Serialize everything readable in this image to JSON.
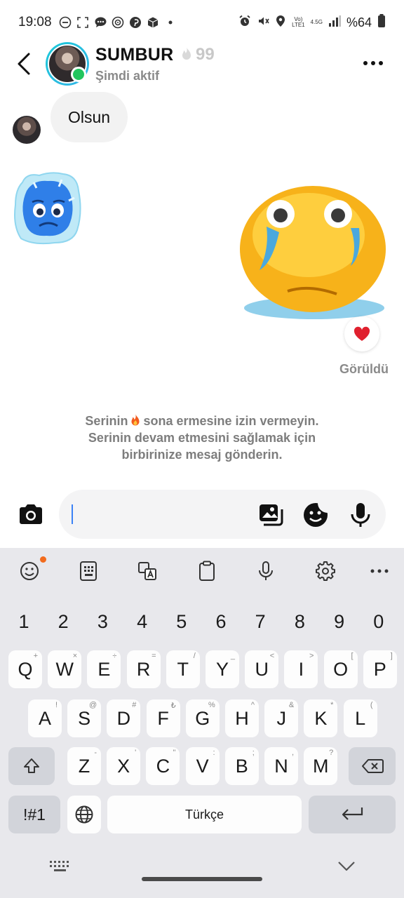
{
  "status_bar": {
    "time": "19:08",
    "network_top": "Vo)",
    "network_bottom": "LTE1",
    "net_gen": "4.5G",
    "battery": "%64",
    "icons": [
      "minus-circle-icon",
      "screenshot-icon",
      "chat-icon",
      "at-icon",
      "pinterest-icon",
      "cube-icon",
      "dot-icon",
      "alarm-icon",
      "mute-icon",
      "location-icon",
      "signal-icon",
      "battery-icon"
    ]
  },
  "header": {
    "contact_name": "SUMBUR",
    "streak_count": "99",
    "status": "Şimdi aktif",
    "accent": "#22c55e",
    "ring_color": "#1cc9d9"
  },
  "messages": [
    {
      "from": "contact",
      "text": "Olsun"
    },
    {
      "from": "contact",
      "sticker": "frozen-sad-sticker"
    },
    {
      "from": "me",
      "sticker": "crying-emoji-sticker",
      "reaction": "heart-icon"
    }
  ],
  "seen_label": "Görüldü",
  "streak_hint": {
    "line1_before": "Serinin",
    "line1_after": "sona ermesine izin vermeyin.",
    "line2": "Serinin devam etmesini sağlamak için",
    "line3": "birbirinize mesaj gönderin."
  },
  "composer": {
    "value": "",
    "placeholder": ""
  },
  "keyboard": {
    "toolbar": [
      "emoji-icon",
      "keypad-icon",
      "translate-icon",
      "clipboard-icon",
      "mic-icon",
      "settings-icon",
      "more-icon"
    ],
    "numbers": [
      "1",
      "2",
      "3",
      "4",
      "5",
      "6",
      "7",
      "8",
      "9",
      "0"
    ],
    "row1": [
      [
        "Q",
        "+"
      ],
      [
        "W",
        "×"
      ],
      [
        "E",
        "÷"
      ],
      [
        "R",
        "="
      ],
      [
        "T",
        "/"
      ],
      [
        "Y",
        "_"
      ],
      [
        "U",
        "<"
      ],
      [
        "I",
        ">"
      ],
      [
        "O",
        "["
      ],
      [
        "P",
        "]"
      ]
    ],
    "row2": [
      [
        "A",
        "!"
      ],
      [
        "S",
        "@"
      ],
      [
        "D",
        "#"
      ],
      [
        "F",
        "₺"
      ],
      [
        "G",
        "%"
      ],
      [
        "H",
        "^"
      ],
      [
        "J",
        "&"
      ],
      [
        "K",
        "*"
      ],
      [
        "L",
        "("
      ]
    ],
    "row3": [
      [
        "Z",
        "-"
      ],
      [
        "X",
        "'"
      ],
      [
        "C",
        "\""
      ],
      [
        "V",
        ":"
      ],
      [
        "B",
        ";"
      ],
      [
        "N",
        ","
      ],
      [
        "M",
        "?"
      ]
    ],
    "sym_label": "!#1",
    "space_label": "Türkçe"
  }
}
